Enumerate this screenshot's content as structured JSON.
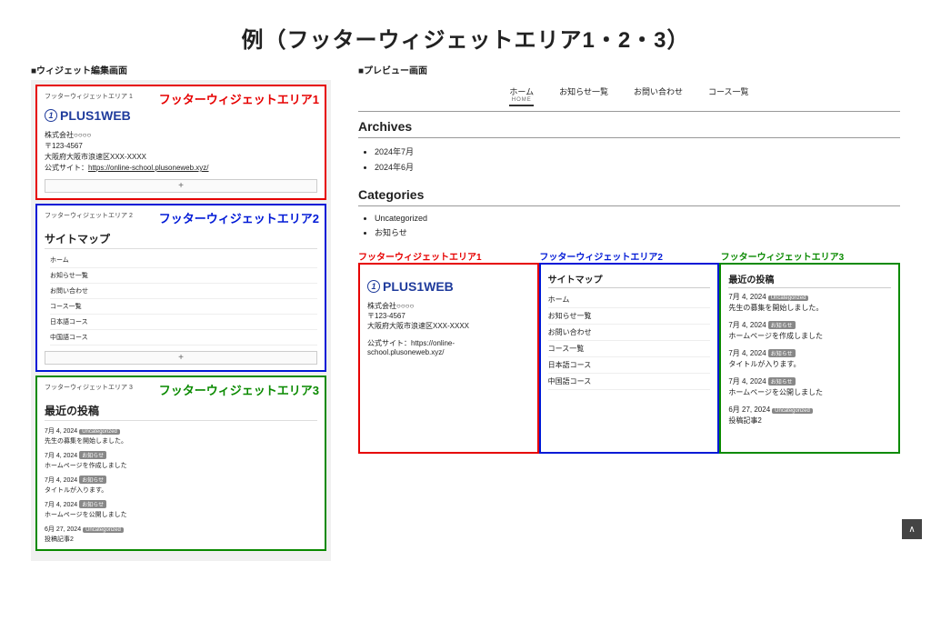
{
  "title": "例（フッターウィジェットエリア1・2・3）",
  "left": {
    "label": "■ウィジェット編集画面",
    "area1": {
      "small": "フッターウィジェットエリア 1",
      "label": "フッターウィジェットエリア1",
      "logo": "PLUS1WEB",
      "company": "株式会社○○○○",
      "postal": "〒123-4567",
      "address": "大阪府大阪市浪速区XXX-XXXX",
      "site_label": "公式サイト：",
      "site_url": "https://online-school.plusoneweb.xyz/",
      "add": "+"
    },
    "area2": {
      "small": "フッターウィジェットエリア 2",
      "label": "フッターウィジェットエリア2",
      "title": "サイトマップ",
      "items": [
        "ホーム",
        "お知らせ一覧",
        "お問い合わせ",
        "コース一覧",
        "日本語コース",
        "中国語コース"
      ],
      "add": "+"
    },
    "area3": {
      "small": "フッターウィジェットエリア 3",
      "label": "フッターウィジェットエリア3",
      "title": "最近の投稿",
      "posts": [
        {
          "date": "7月 4, 2024",
          "tag": "Uncategorized",
          "title": "先生の募集を開始しました。"
        },
        {
          "date": "7月 4, 2024",
          "tag": "お知らせ",
          "title": "ホームページを作成しました"
        },
        {
          "date": "7月 4, 2024",
          "tag": "お知らせ",
          "title": "タイトルが入ります。"
        },
        {
          "date": "7月 4, 2024",
          "tag": "お知らせ",
          "title": "ホームページを公開しました"
        },
        {
          "date": "6月 27, 2024",
          "tag": "Uncategorized",
          "title": "投稿記事2"
        }
      ]
    }
  },
  "right": {
    "label": "■プレビュー画面",
    "nav": [
      {
        "label": "ホーム",
        "sub": "HOME",
        "active": true
      },
      {
        "label": "お知らせ一覧"
      },
      {
        "label": "お問い合わせ"
      },
      {
        "label": "コース一覧"
      }
    ],
    "archives_title": "Archives",
    "archives": [
      "2024年7月",
      "2024年6月"
    ],
    "categories_title": "Categories",
    "categories": [
      "Uncategorized",
      "お知らせ"
    ],
    "footer_labels": [
      "フッターウィジェットエリア1",
      "フッターウィジェットエリア2",
      "フッターウィジェットエリア3"
    ],
    "footer1": {
      "logo": "PLUS1WEB",
      "company": "株式会社○○○○",
      "postal": "〒123-4567",
      "address": "大阪府大阪市浪速区XXX-XXXX",
      "site_label": "公式サイト：",
      "site_url": "https://online-school.plusoneweb.xyz/"
    },
    "footer2": {
      "title": "サイトマップ",
      "items": [
        "ホーム",
        "お知らせ一覧",
        "お問い合わせ",
        "コース一覧"
      ],
      "sub": [
        "日本語コース",
        "中国語コース"
      ]
    },
    "footer3": {
      "title": "最近の投稿",
      "posts": [
        {
          "date": "7月 4, 2024",
          "tag": "Uncategorized",
          "title": "先生の募集を開始しました。"
        },
        {
          "date": "7月 4, 2024",
          "tag": "お知らせ",
          "title": "ホームページを作成しました"
        },
        {
          "date": "7月 4, 2024",
          "tag": "お知らせ",
          "title": "タイトルが入ります。"
        },
        {
          "date": "7月 4, 2024",
          "tag": "お知らせ",
          "title": "ホームページを公開しました"
        },
        {
          "date": "6月 27, 2024",
          "tag": "Uncategorized",
          "title": "投稿記事2"
        }
      ]
    },
    "scroll_top": "∧"
  }
}
